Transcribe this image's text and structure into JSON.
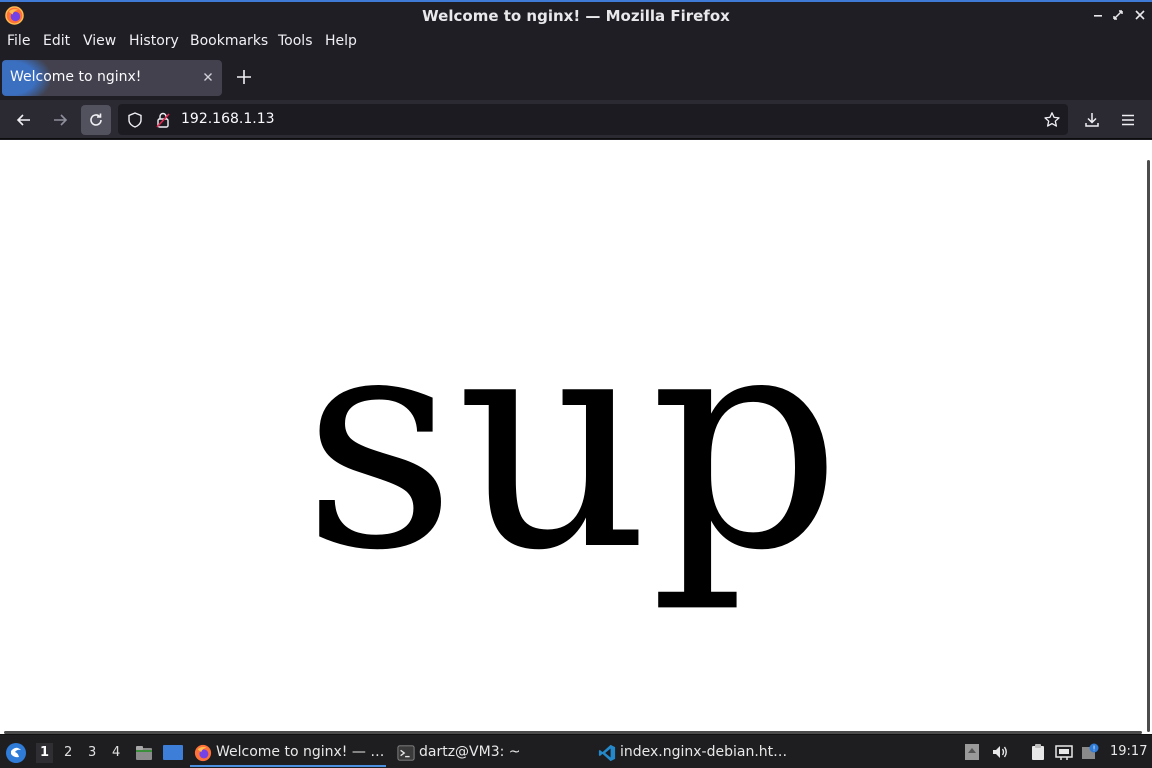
{
  "window": {
    "title": "Welcome to nginx! — Mozilla Firefox",
    "controls": [
      "minimize",
      "maximize",
      "close"
    ]
  },
  "menu": {
    "items": [
      "File",
      "Edit",
      "View",
      "History",
      "Bookmarks",
      "Tools",
      "Help"
    ]
  },
  "tabs": [
    {
      "label": "Welcome to nginx!",
      "active": true,
      "loading": true
    }
  ],
  "navbar": {
    "url": "192.168.1.13"
  },
  "page": {
    "text": "sup"
  },
  "taskbar": {
    "workspaces": [
      "1",
      "2",
      "3",
      "4"
    ],
    "active_workspace": "1",
    "tasks": [
      {
        "label": "Welcome to nginx! — …",
        "icon": "firefox-icon",
        "active": true
      },
      {
        "label": "dartz@VM3: ~",
        "icon": "terminal-icon",
        "active": false
      },
      {
        "label": "index.nginx-debian.ht…",
        "icon": "vscode-icon",
        "active": false
      }
    ],
    "clock": "19:17"
  },
  "colors": {
    "accent": "#3f7bd6",
    "chrome_bg": "#1f1e25",
    "toolbar_bg": "#2b2a33",
    "urlbar_bg": "#1c1b22",
    "content_bg": "#ffffff"
  }
}
